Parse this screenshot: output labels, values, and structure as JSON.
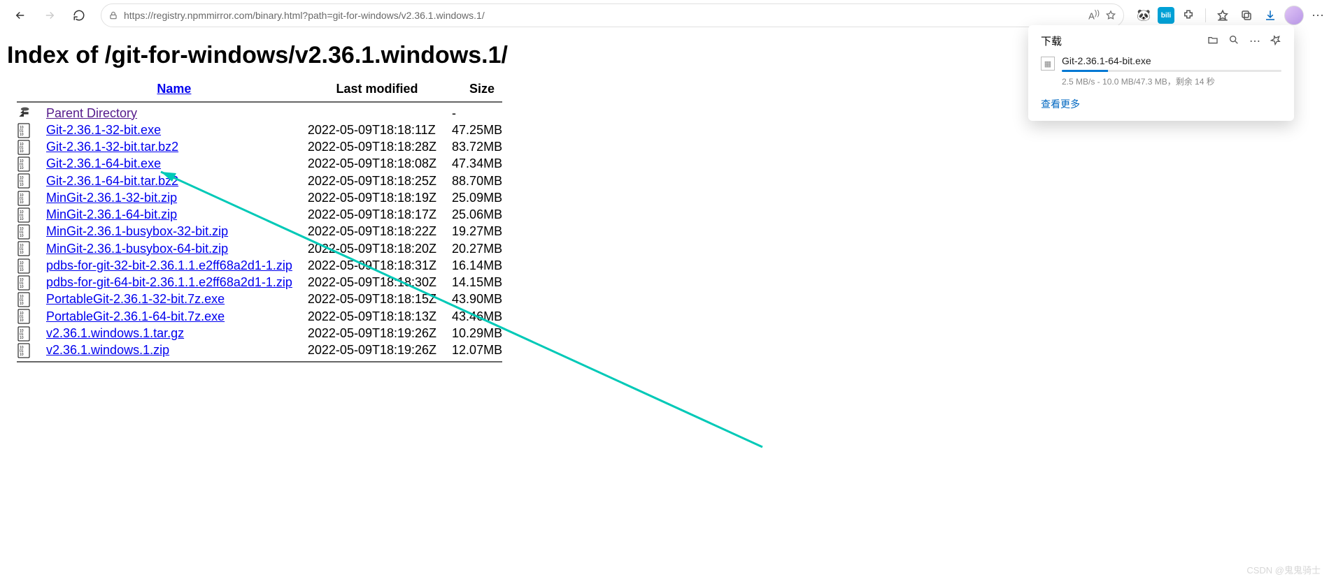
{
  "browser": {
    "url": "https://registry.npmmirror.com/binary.html?path=git-for-windows/v2.36.1.windows.1/"
  },
  "page": {
    "heading": "Index of /git-for-windows/v2.36.1.windows.1/",
    "columns": {
      "name": "Name",
      "modified": "Last modified",
      "size": "Size"
    },
    "parent_label": "Parent Directory",
    "files": [
      {
        "name": "Git-2.36.1-32-bit.exe",
        "modified": "2022-05-09T18:18:11Z",
        "size": "47.25MB"
      },
      {
        "name": "Git-2.36.1-32-bit.tar.bz2",
        "modified": "2022-05-09T18:18:28Z",
        "size": "83.72MB"
      },
      {
        "name": "Git-2.36.1-64-bit.exe",
        "modified": "2022-05-09T18:18:08Z",
        "size": "47.34MB"
      },
      {
        "name": "Git-2.36.1-64-bit.tar.bz2",
        "modified": "2022-05-09T18:18:25Z",
        "size": "88.70MB"
      },
      {
        "name": "MinGit-2.36.1-32-bit.zip",
        "modified": "2022-05-09T18:18:19Z",
        "size": "25.09MB"
      },
      {
        "name": "MinGit-2.36.1-64-bit.zip",
        "modified": "2022-05-09T18:18:17Z",
        "size": "25.06MB"
      },
      {
        "name": "MinGit-2.36.1-busybox-32-bit.zip",
        "modified": "2022-05-09T18:18:22Z",
        "size": "19.27MB"
      },
      {
        "name": "MinGit-2.36.1-busybox-64-bit.zip",
        "modified": "2022-05-09T18:18:20Z",
        "size": "20.27MB"
      },
      {
        "name": "pdbs-for-git-32-bit-2.36.1.1.e2ff68a2d1-1.zip",
        "modified": "2022-05-09T18:18:31Z",
        "size": "16.14MB"
      },
      {
        "name": "pdbs-for-git-64-bit-2.36.1.1.e2ff68a2d1-1.zip",
        "modified": "2022-05-09T18:18:30Z",
        "size": "14.15MB"
      },
      {
        "name": "PortableGit-2.36.1-32-bit.7z.exe",
        "modified": "2022-05-09T18:18:15Z",
        "size": "43.90MB"
      },
      {
        "name": "PortableGit-2.36.1-64-bit.7z.exe",
        "modified": "2022-05-09T18:18:13Z",
        "size": "43.46MB"
      },
      {
        "name": "v2.36.1.windows.1.tar.gz",
        "modified": "2022-05-09T18:19:26Z",
        "size": "10.29MB"
      },
      {
        "name": "v2.36.1.windows.1.zip",
        "modified": "2022-05-09T18:19:26Z",
        "size": "12.07MB"
      }
    ]
  },
  "download_panel": {
    "title": "下载",
    "item": {
      "name": "Git-2.36.1-64-bit.exe",
      "stats": "2.5 MB/s - 10.0 MB/47.3 MB，剩余 14 秒"
    },
    "more": "查看更多"
  },
  "watermark": "CSDN @鬼鬼骑士"
}
